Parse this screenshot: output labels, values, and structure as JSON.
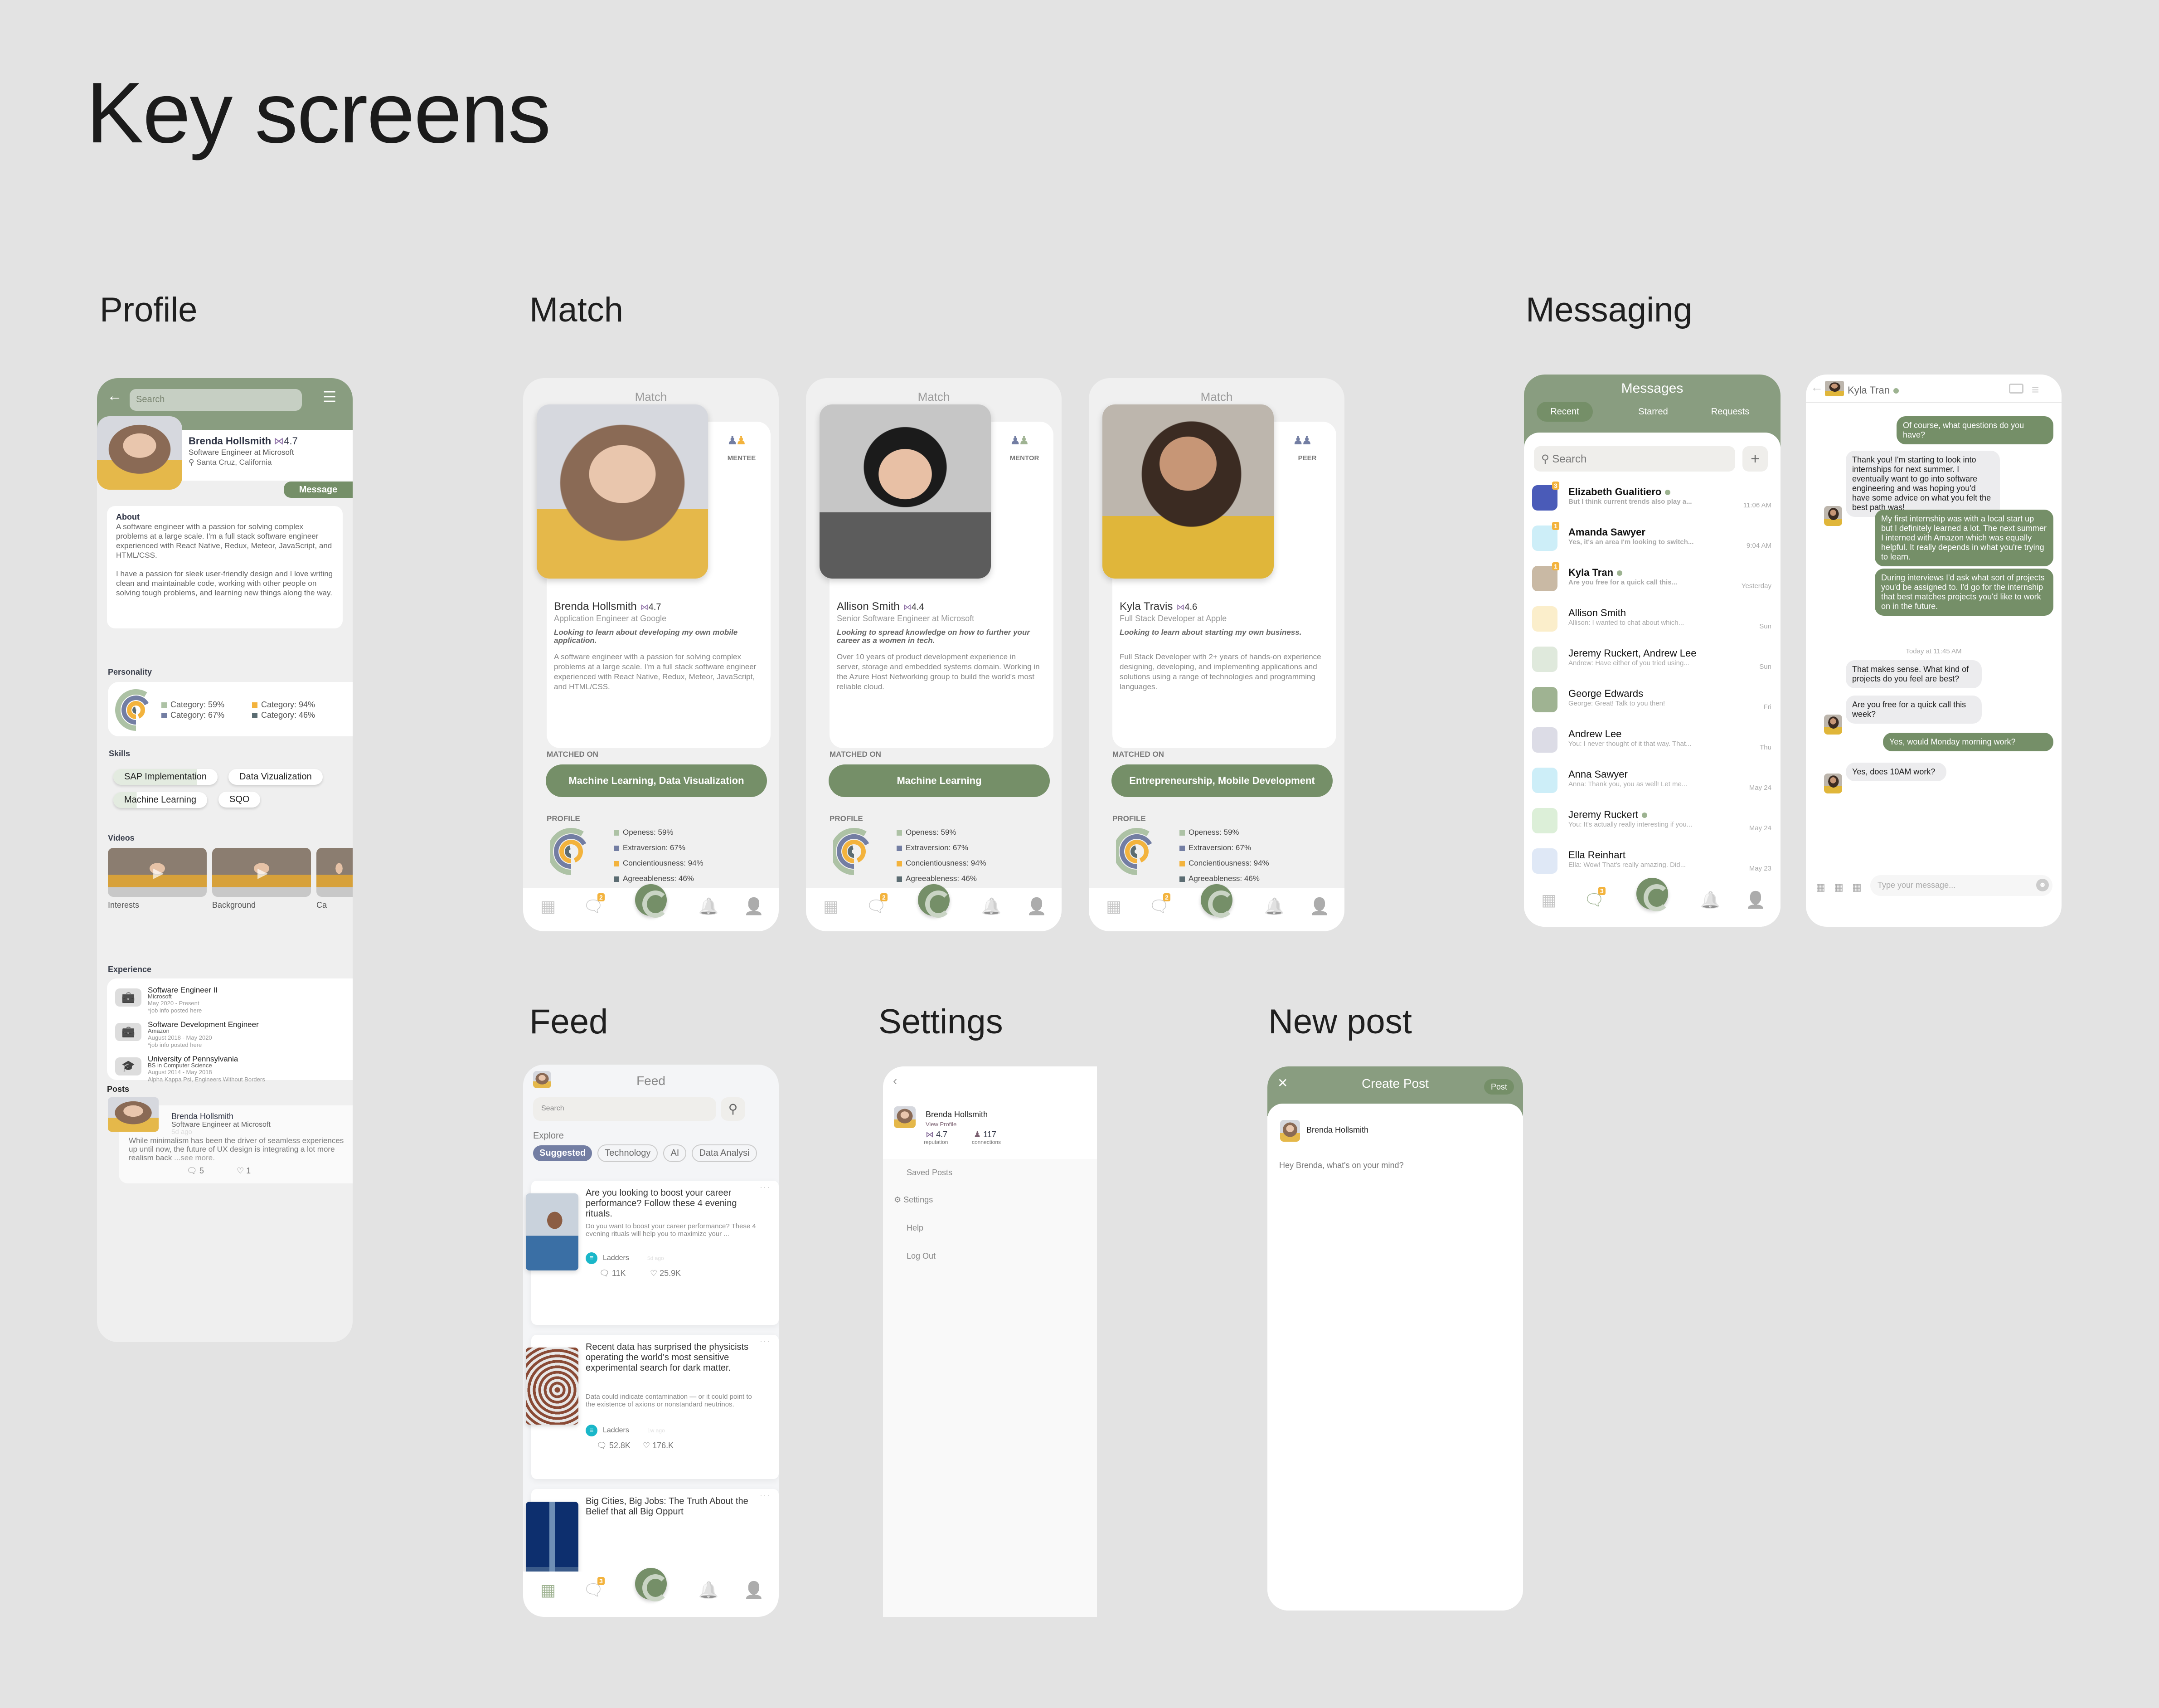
{
  "page": {
    "title": "Key screens",
    "sections": {
      "profile": "Profile",
      "match": "Match",
      "messaging": "Messaging",
      "feed": "Feed",
      "settings": "Settings",
      "new_post": "New post"
    }
  },
  "colors": {
    "brand_green": "#899d80",
    "dark_green": "#758f68",
    "accent_yellow": "#f3b33d",
    "accent_purple": "#737ea3",
    "background": "#e3e3e3"
  },
  "profile": {
    "search_placeholder": "Search",
    "name": "Brenda Hollsmith",
    "rating": "4.7",
    "job": "Software Engineer at Microsoft",
    "location": "Santa Cruz, California",
    "message_button": "Message",
    "about_title": "About",
    "about_p1": "A software engineer with a passion for solving complex problems at a large scale. I'm a full stack software engineer experienced with React Native, Redux, Meteor, JavaScript, and HTML/CSS.",
    "about_p2": "I have a passion for sleek user-friendly design and I love writing clean and maintainable code, working with other people on solving tough problems, and learning new things along the way.",
    "personality_title": "Personality",
    "personality_legend": [
      {
        "label": "Category: 59%",
        "color": "#adc2a5"
      },
      {
        "label": "Category: 94%",
        "color": "#f3b33d"
      },
      {
        "label": "Category: 67%",
        "color": "#737ea3"
      },
      {
        "label": "Category: 46%",
        "color": "#5b6c72"
      }
    ],
    "skills_title": "Skills",
    "skills": [
      "SAP Implementation",
      "Data Vizualization",
      "Machine Learning",
      "SQO"
    ],
    "videos_title": "Videos",
    "videos": [
      "Interests",
      "Background",
      "Ca"
    ],
    "experience_title": "Experience",
    "experience": [
      {
        "title": "Software Engineer II",
        "org": "Microsoft",
        "dates": "May 2020 - Present",
        "note": "*job info posted here"
      },
      {
        "title": "Software Development Engineer",
        "org": "Amazon",
        "dates": "August 2018 - May 2020",
        "note": "*job info posted here"
      },
      {
        "title": "University of Pennsylvania",
        "org": "BS in Computer Science",
        "dates": "August 2014 - May 2018",
        "note": "Alpha Kappa Psi, Engineers Without Borders"
      }
    ],
    "posts_title": "Posts",
    "post": {
      "author": "Brenda Hollsmith",
      "job": "Software Engineer at Microsoft",
      "time": "5d ago",
      "body": "While minimalism has been the driver of seamless experiences up until now, the future of UX design is integrating a lot more realism back",
      "see_more": "...see more.",
      "comments": "5",
      "likes": "1"
    }
  },
  "match": {
    "header": "Match",
    "matched_on_label": "MATCHED ON",
    "profile_label": "PROFILE",
    "traits": [
      {
        "label": "Openess: 59%",
        "color": "#adc2a5"
      },
      {
        "label": "Extraversion: 67%",
        "color": "#737ea3"
      },
      {
        "label": "Concientiousness: 94%",
        "color": "#f3b33d"
      },
      {
        "label": "Agreeableness: 46%",
        "color": "#5b6c72"
      }
    ],
    "cards": [
      {
        "role": "MENTEE",
        "name": "Brenda Hollsmith",
        "rating": "4.7",
        "job": "Application Engineer at Google",
        "goal": "Looking to learn about developing my own mobile application.",
        "bio": "A software engineer with a passion for solving complex problems at a large scale. I'm a full stack software engineer experienced with React Native, Redux, Meteor, JavaScript, and HTML/CSS.",
        "matched_on": "Machine Learning, Data Visualization",
        "nav_badge": "2"
      },
      {
        "role": "MENTOR",
        "name": "Allison Smith",
        "rating": "4.4",
        "job": "Senior Software Engineer at Microsoft",
        "goal": "Looking to spread knowledge on how to further your career as a women in tech.",
        "bio": "Over 10 years of product development experience in server, storage and embedded systems domain. Working in the Azure Host Networking group to build the world's most reliable cloud.",
        "matched_on": "Machine Learning",
        "nav_badge": "2"
      },
      {
        "role": "PEER",
        "name": "Kyla Travis",
        "rating": "4.6",
        "job": "Full Stack Developer at Apple",
        "goal": "Looking to learn about starting my own business.",
        "bio": "Full Stack Developer with 2+ years of hands-on experience designing, developing, and implementing applications and solutions using a range of technologies and programming languages.",
        "matched_on": "Entrepreneurship, Mobile Development",
        "nav_badge": "2"
      }
    ]
  },
  "chart_data": {
    "type": "radial-bar",
    "title": "Personality",
    "categories": [
      "Openess",
      "Extraversion",
      "Concientiousness",
      "Agreeableness"
    ],
    "values": [
      59,
      67,
      94,
      46
    ],
    "colors": [
      "#adc2a5",
      "#737ea3",
      "#f3b33d",
      "#5b6c72"
    ],
    "ylim": [
      0,
      100
    ]
  },
  "messages": {
    "title": "Messages",
    "tabs": [
      "Recent",
      "Starred",
      "Requests"
    ],
    "active_tab": "Recent",
    "search_placeholder": "Search",
    "nav_badge": "3",
    "conversations": [
      {
        "name": "Elizabeth Gualitiero",
        "online": true,
        "unread": "3",
        "preview": "But I think current trends also play a...",
        "time": "11:06 AM",
        "bold": true,
        "avatar": "#4a5bb8"
      },
      {
        "name": "Amanda Sawyer",
        "online": false,
        "unread": "1",
        "preview": "Yes, it's an area I'm looking to switch...",
        "time": "9:04 AM",
        "bold": true,
        "avatar": "#cdeef8"
      },
      {
        "name": "Kyla Tran",
        "online": true,
        "unread": "1",
        "preview": "Are you free for a quick call this...",
        "time": "Yesterday",
        "bold": true,
        "avatar": "#c9b9a4"
      },
      {
        "name": "Allison Smith",
        "online": false,
        "unread": "",
        "preview": "Allison: I wanted to chat about which...",
        "time": "Sun",
        "bold": false,
        "avatar": "#fbeecb"
      },
      {
        "name": "Jeremy Ruckert, Andrew Lee",
        "online": false,
        "unread": "",
        "preview": "Andrew: Have either of you tried using...",
        "time": "Sun",
        "bold": false,
        "avatar": "#dfe9dc"
      },
      {
        "name": "George Edwards",
        "online": false,
        "unread": "",
        "preview": "George: Great! Talk to you then!",
        "time": "Fri",
        "bold": false,
        "avatar": "#9fb392"
      },
      {
        "name": "Andrew Lee",
        "online": false,
        "unread": "",
        "preview": "You: I never thought of it that way. That...",
        "time": "Thu",
        "bold": false,
        "avatar": "#dcdce6"
      },
      {
        "name": "Anna Sawyer",
        "online": false,
        "unread": "",
        "preview": "Anna: Thank you, you as well! Let me...",
        "time": "May 24",
        "bold": false,
        "avatar": "#cdeef8"
      },
      {
        "name": "Jeremy Ruckert",
        "online": true,
        "unread": "",
        "preview": "You: It's actually really interesting if you...",
        "time": "May 24",
        "bold": false,
        "avatar": "#dcefd8"
      },
      {
        "name": "Ella Reinhart",
        "online": false,
        "unread": "",
        "preview": "Ella: Wow! That's really amazing. Did...",
        "time": "May 23",
        "bold": false,
        "avatar": "#dfe8f6"
      }
    ]
  },
  "chat": {
    "contact": "Kyla Tran",
    "timestamp": "Today at 11:45 AM",
    "input_placeholder": "Type your message...",
    "messages": [
      {
        "from": "me",
        "text": "Of course, what questions do you have?"
      },
      {
        "from": "them",
        "text": "Thank you! I'm starting to look into internships for next summer. I eventually want to go into software engineering and was hoping you'd have some advice on what you felt the best path was!"
      },
      {
        "from": "me",
        "text": "My first internship was with a local start up but I definitely learned a lot. The next summer I interned with Amazon which was equally helpful. It really depends in what you're trying to learn."
      },
      {
        "from": "me",
        "text": "During interviews I'd ask what sort of projects you'd be assigned to. I'd go for the internship that best matches projects you'd like to work on in the future."
      },
      {
        "from": "them",
        "text": "That makes sense. What kind of projects do you feel are best?"
      },
      {
        "from": "them",
        "text": "Are you free for a quick call this week?"
      },
      {
        "from": "me",
        "text": "Yes, would Monday morning work?"
      },
      {
        "from": "them",
        "text": "Yes, does 10AM work?"
      }
    ]
  },
  "feed": {
    "title": "Feed",
    "search_placeholder": "Search",
    "explore_label": "Explore",
    "filters": [
      "Suggested",
      "Technology",
      "AI",
      "Data Analysi"
    ],
    "active_filter": "Suggested",
    "nav_badge": "3",
    "posts": [
      {
        "title": "Are you looking to boost your career performance? Follow these 4 evening rituals.",
        "summary": "Do you want to boost your career performance? These 4 evening rituals will help you to maximize your ...",
        "source": "Ladders",
        "time": "5d ago",
        "comments": "11K",
        "likes": "25.9K"
      },
      {
        "title": "Recent data has surprised the physicists operating the world's most sensitive experimental search for dark matter.",
        "summary": "Data could indicate contamination — or it could point to the existence of axions or nonstandard neutrinos.",
        "source": "Ladders",
        "time": "1w ago",
        "comments": "52.8K",
        "likes": "176.K"
      },
      {
        "title": "Big Cities, Big Jobs: The Truth About the Belief that all Big Oppurt",
        "summary": "",
        "source": "",
        "time": "",
        "comments": "",
        "likes": ""
      }
    ]
  },
  "settings": {
    "name": "Brenda Hollsmith",
    "view_profile": "View Profile",
    "reputation_value": "4.7",
    "reputation_label": "reputation",
    "connections_value": "117",
    "connections_label": "connections",
    "menu": [
      "Saved Posts",
      "Settings",
      "Help",
      "Log Out"
    ]
  },
  "new_post": {
    "title": "Create Post",
    "post_button": "Post",
    "author": "Brenda Hollsmith",
    "placeholder": "Hey Brenda, what's on your mind?"
  }
}
